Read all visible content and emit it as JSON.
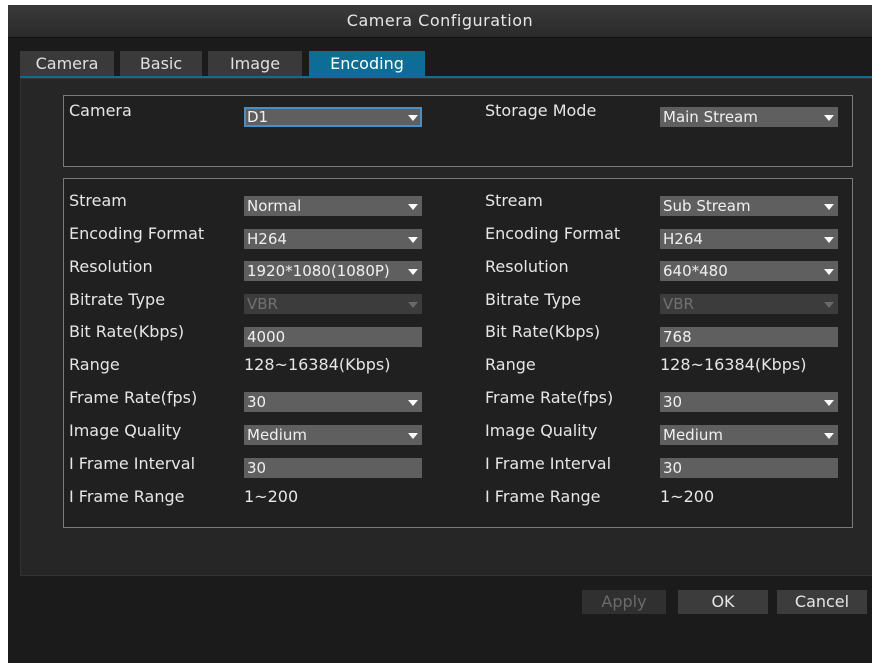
{
  "window": {
    "title": "Camera Configuration"
  },
  "tabs": [
    {
      "label": "Camera",
      "active": false
    },
    {
      "label": "Basic",
      "active": false
    },
    {
      "label": "Image",
      "active": false
    },
    {
      "label": "Encoding",
      "active": true
    }
  ],
  "top_panel": {
    "camera_label": "Camera",
    "camera_value": "D1",
    "storage_mode_label": "Storage Mode",
    "storage_mode_value": "Main Stream"
  },
  "main_stream": {
    "stream_label": "Stream",
    "stream_value": "Normal",
    "encoding_format_label": "Encoding Format",
    "encoding_format_value": "H264",
    "resolution_label": "Resolution",
    "resolution_value": "1920*1080(1080P)",
    "bitrate_type_label": "Bitrate Type",
    "bitrate_type_value": "VBR",
    "bit_rate_label": "Bit Rate(Kbps)",
    "bit_rate_value": "4000",
    "range_label": "Range",
    "range_value": "128~16384(Kbps)",
    "frame_rate_label": "Frame Rate(fps)",
    "frame_rate_value": "30",
    "image_quality_label": "Image Quality",
    "image_quality_value": "Medium",
    "i_frame_interval_label": "I Frame Interval",
    "i_frame_interval_value": "30",
    "i_frame_range_label": "I Frame Range",
    "i_frame_range_value": "1~200"
  },
  "sub_stream": {
    "stream_label": "Stream",
    "stream_value": "Sub Stream",
    "encoding_format_label": "Encoding Format",
    "encoding_format_value": "H264",
    "resolution_label": "Resolution",
    "resolution_value": "640*480",
    "bitrate_type_label": "Bitrate Type",
    "bitrate_type_value": "VBR",
    "bit_rate_label": "Bit Rate(Kbps)",
    "bit_rate_value": "768",
    "range_label": "Range",
    "range_value": "128~16384(Kbps)",
    "frame_rate_label": "Frame Rate(fps)",
    "frame_rate_value": "30",
    "image_quality_label": "Image Quality",
    "image_quality_value": "Medium",
    "i_frame_interval_label": "I Frame Interval",
    "i_frame_interval_value": "30",
    "i_frame_range_label": "I Frame Range",
    "i_frame_range_value": "1~200"
  },
  "buttons": {
    "apply": "Apply",
    "ok": "OK",
    "cancel": "Cancel"
  },
  "colors": {
    "accent": "#0e6d96",
    "background": "#1b1b1b",
    "field": "#5f5f5f"
  },
  "icons": {
    "dropdown": "chevron-down-icon"
  }
}
